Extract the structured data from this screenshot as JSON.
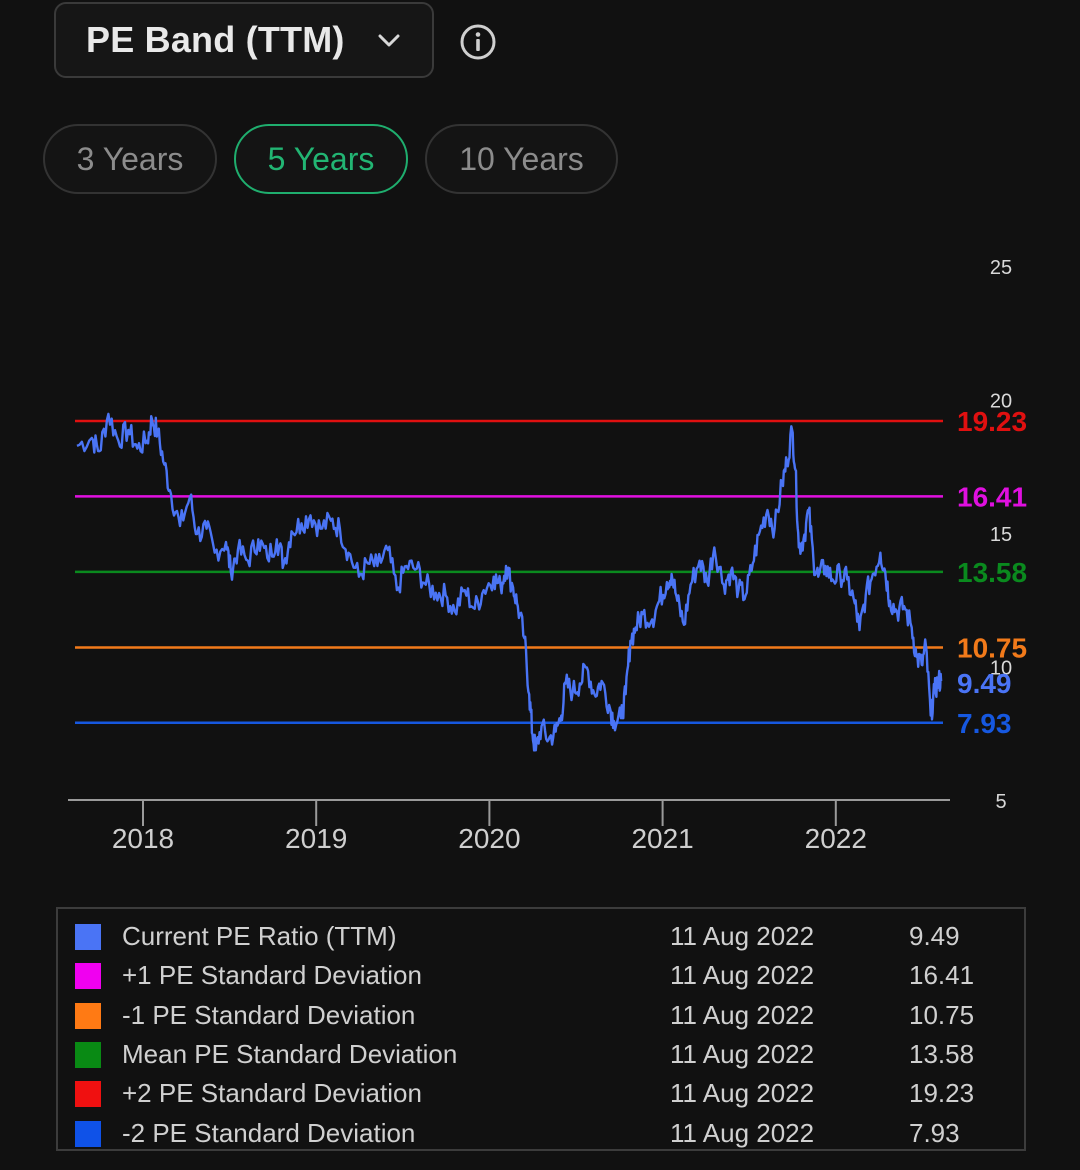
{
  "header": {
    "dropdown_label": "PE Band (TTM)",
    "dropdown_icon": "chevron-down-icon",
    "info_icon": "info-icon"
  },
  "ranges": [
    {
      "label": "3 Years",
      "active": false
    },
    {
      "label": "5 Years",
      "active": true
    },
    {
      "label": "10 Years",
      "active": false
    }
  ],
  "chart_data": {
    "type": "line",
    "title": "",
    "xlabel": "",
    "ylabel": "",
    "x_ticks": [
      "2018",
      "2019",
      "2020",
      "2021",
      "2022"
    ],
    "y_ticks": [
      5,
      10,
      15,
      20,
      25
    ],
    "ylim": [
      5,
      25
    ],
    "x_range": [
      "2017-08",
      "2022-08"
    ],
    "grid": false,
    "series": [
      {
        "name": "Current PE Ratio (TTM)",
        "color": "#4a74f5",
        "points": [
          [
            "2017-08-15",
            18.3
          ],
          [
            "2017-09-15",
            18.6
          ],
          [
            "2017-10-01",
            18.1
          ],
          [
            "2017-10-20",
            19.5
          ],
          [
            "2017-11-10",
            18.5
          ],
          [
            "2017-12-01",
            18.9
          ],
          [
            "2017-12-20",
            18.2
          ],
          [
            "2018-01-10",
            18.5
          ],
          [
            "2018-01-20",
            19.3
          ],
          [
            "2018-02-01",
            18.8
          ],
          [
            "2018-02-15",
            17.6
          ],
          [
            "2018-03-01",
            16.5
          ],
          [
            "2018-03-20",
            15.3
          ],
          [
            "2018-04-10",
            16.4
          ],
          [
            "2018-04-25",
            15.0
          ],
          [
            "2018-05-15",
            15.2
          ],
          [
            "2018-06-01",
            14.3
          ],
          [
            "2018-06-25",
            14.7
          ],
          [
            "2018-07-05",
            13.6
          ],
          [
            "2018-07-20",
            14.4
          ],
          [
            "2018-08-10",
            14.0
          ],
          [
            "2018-09-01",
            14.8
          ],
          [
            "2018-09-20",
            14.1
          ],
          [
            "2018-10-10",
            14.8
          ],
          [
            "2018-10-25",
            13.9
          ],
          [
            "2018-11-10",
            15.1
          ],
          [
            "2018-12-01",
            15.4
          ],
          [
            "2018-12-20",
            15.7
          ],
          [
            "2019-01-10",
            15.2
          ],
          [
            "2019-02-01",
            15.5
          ],
          [
            "2019-02-20",
            15.2
          ],
          [
            "2019-03-10",
            14.3
          ],
          [
            "2019-04-01",
            13.4
          ],
          [
            "2019-04-20",
            13.9
          ],
          [
            "2019-05-10",
            13.8
          ],
          [
            "2019-06-01",
            14.4
          ],
          [
            "2019-06-20",
            12.9
          ],
          [
            "2019-07-10",
            13.8
          ],
          [
            "2019-08-01",
            13.7
          ],
          [
            "2019-08-20",
            13.1
          ],
          [
            "2019-09-10",
            12.8
          ],
          [
            "2019-10-01",
            12.7
          ],
          [
            "2019-10-20",
            12.1
          ],
          [
            "2019-11-10",
            12.9
          ],
          [
            "2019-12-01",
            12.2
          ],
          [
            "2019-12-20",
            12.9
          ],
          [
            "2020-01-10",
            13.4
          ],
          [
            "2020-01-25",
            13.0
          ],
          [
            "2020-02-05",
            13.8
          ],
          [
            "2020-02-20",
            13.0
          ],
          [
            "2020-03-01",
            12.3
          ],
          [
            "2020-03-15",
            11.1
          ],
          [
            "2020-03-25",
            9.0
          ],
          [
            "2020-04-01",
            7.5
          ],
          [
            "2020-04-08",
            6.9
          ],
          [
            "2020-04-20",
            7.8
          ],
          [
            "2020-05-05",
            7.3
          ],
          [
            "2020-05-20",
            7.6
          ],
          [
            "2020-06-01",
            8.2
          ],
          [
            "2020-06-10",
            9.4
          ],
          [
            "2020-06-25",
            9.1
          ],
          [
            "2020-07-10",
            9.4
          ],
          [
            "2020-07-25",
            10.0
          ],
          [
            "2020-08-10",
            9.0
          ],
          [
            "2020-08-25",
            9.5
          ],
          [
            "2020-09-10",
            8.6
          ],
          [
            "2020-09-20",
            8.0
          ],
          [
            "2020-10-05",
            8.1
          ],
          [
            "2020-10-15",
            9.0
          ],
          [
            "2020-10-25",
            11.0
          ],
          [
            "2020-11-05",
            11.5
          ],
          [
            "2020-11-20",
            12.0
          ],
          [
            "2020-12-10",
            11.8
          ],
          [
            "2020-12-25",
            12.5
          ],
          [
            "2021-01-10",
            13.2
          ],
          [
            "2021-01-20",
            13.5
          ],
          [
            "2021-02-01",
            12.5
          ],
          [
            "2021-02-15",
            11.6
          ],
          [
            "2021-03-01",
            13.1
          ],
          [
            "2021-03-20",
            14.0
          ],
          [
            "2021-04-05",
            13.2
          ],
          [
            "2021-04-20",
            14.5
          ],
          [
            "2021-05-10",
            13.1
          ],
          [
            "2021-05-25",
            13.6
          ],
          [
            "2021-06-10",
            12.9
          ],
          [
            "2021-06-25",
            12.7
          ],
          [
            "2021-07-10",
            13.9
          ],
          [
            "2021-07-25",
            15.1
          ],
          [
            "2021-08-10",
            15.9
          ],
          [
            "2021-08-25",
            15.2
          ],
          [
            "2021-09-10",
            16.9
          ],
          [
            "2021-09-20",
            17.7
          ],
          [
            "2021-10-01",
            18.9
          ],
          [
            "2021-10-08",
            17.4
          ],
          [
            "2021-10-15",
            14.5
          ],
          [
            "2021-10-25",
            14.8
          ],
          [
            "2021-11-05",
            15.9
          ],
          [
            "2021-11-15",
            14.0
          ],
          [
            "2021-11-25",
            13.4
          ],
          [
            "2021-12-10",
            13.8
          ],
          [
            "2021-12-25",
            13.3
          ],
          [
            "2022-01-10",
            13.5
          ],
          [
            "2022-01-25",
            13.3
          ],
          [
            "2022-02-10",
            12.4
          ],
          [
            "2022-02-20",
            11.4
          ],
          [
            "2022-03-05",
            12.7
          ],
          [
            "2022-03-20",
            13.5
          ],
          [
            "2022-04-05",
            14.3
          ],
          [
            "2022-04-15",
            13.6
          ],
          [
            "2022-04-25",
            12.5
          ],
          [
            "2022-05-10",
            12.1
          ],
          [
            "2022-05-25",
            12.3
          ],
          [
            "2022-06-10",
            11.5
          ],
          [
            "2022-06-20",
            10.4
          ],
          [
            "2022-07-01",
            10.1
          ],
          [
            "2022-07-10",
            10.8
          ],
          [
            "2022-07-20",
            8.2
          ],
          [
            "2022-07-28",
            9.1
          ],
          [
            "2022-08-05",
            9.5
          ],
          [
            "2022-08-11",
            9.49
          ]
        ]
      }
    ],
    "bands": [
      {
        "name": "+2 PE Standard Deviation",
        "value": 19.23,
        "color": "#e01010"
      },
      {
        "name": "+1 PE Standard Deviation",
        "value": 16.41,
        "color": "#e010e0"
      },
      {
        "name": "Mean PE Standard Deviation",
        "value": 13.58,
        "color": "#0a8a1e"
      },
      {
        "name": "-1 PE Standard Deviation",
        "value": 10.75,
        "color": "#f27a1a"
      },
      {
        "name": "-2 PE Standard Deviation",
        "value": 7.93,
        "color": "#1658e0"
      }
    ],
    "current_label": {
      "value": 9.49,
      "color": "#4a74f5"
    }
  },
  "legend": [
    {
      "name": "Current PE Ratio (TTM)",
      "date": "11 Aug 2022",
      "value": "9.49",
      "color": "#4a74f5"
    },
    {
      "name": "+1 PE Standard Deviation",
      "date": "11 Aug 2022",
      "value": "16.41",
      "color": "#f000f0"
    },
    {
      "name": "-1 PE Standard Deviation",
      "date": "11 Aug 2022",
      "value": "10.75",
      "color": "#ff7a14"
    },
    {
      "name": "Mean PE Standard Deviation",
      "date": "11 Aug 2022",
      "value": "13.58",
      "color": "#098a14"
    },
    {
      "name": "+2 PE Standard Deviation",
      "date": "11 Aug 2022",
      "value": "19.23",
      "color": "#f01010"
    },
    {
      "name": "-2 PE Standard Deviation",
      "date": "11 Aug 2022",
      "value": "7.93",
      "color": "#0f52e8"
    }
  ]
}
